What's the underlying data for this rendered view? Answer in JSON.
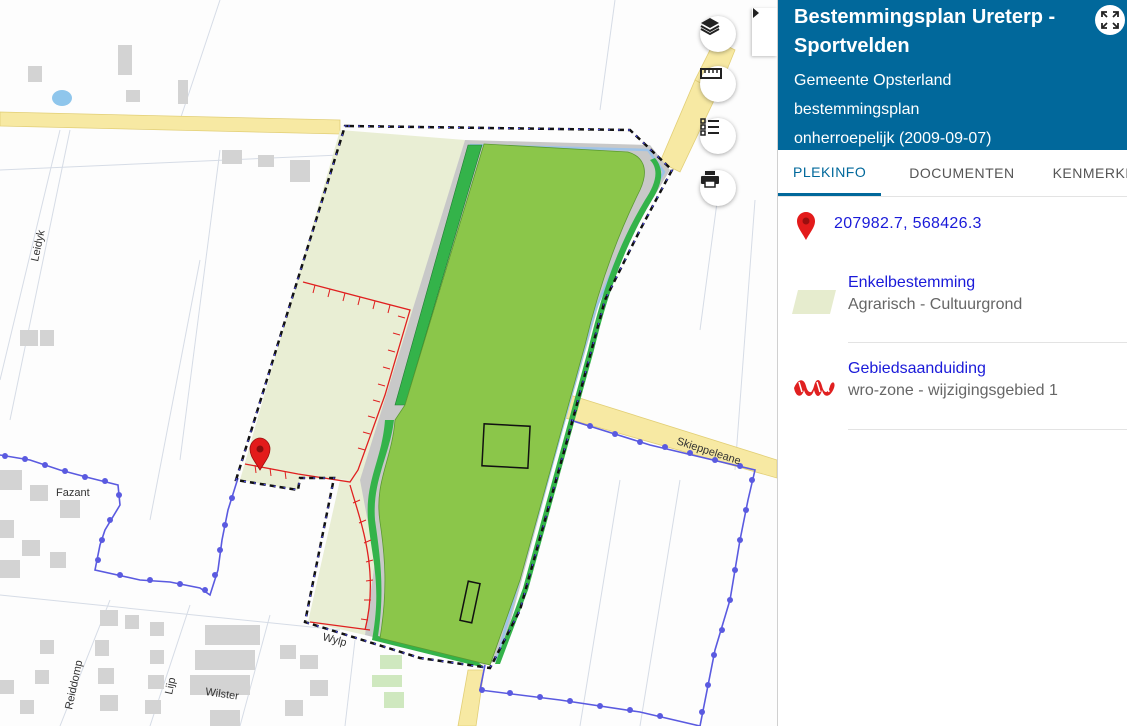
{
  "map": {
    "street_labels": [
      "Leidyk",
      "Fazant",
      "Wylp",
      "Skieppeleane",
      "Reiddomp",
      "Lijp",
      "Wilster"
    ],
    "controls": [
      "layers-icon",
      "ruler-icon",
      "legend-icon",
      "print-icon"
    ],
    "colors": {
      "sport_green": "#8bc64a",
      "dark_green": "#34b34a",
      "agrarisch": "#e9eed4",
      "road_yellow": "#f7e9a3",
      "gray_strip": "#c8c8c8",
      "boundary_black": "#111111",
      "boundary_blue": "#5a5ae0",
      "zone_red": "#e02020"
    }
  },
  "panel": {
    "title": "Bestemmingsplan Ureterp - Sportvelden",
    "municipality": "Gemeente Opsterland",
    "type": "bestemmingsplan",
    "status": "onherroepelijk (2009-09-07)",
    "tabs": [
      "PLEKINFO",
      "DOCUMENTEN",
      "KENMERKEN"
    ],
    "active_tab": "PLEKINFO",
    "coordinates": "207982.7, 568426.3",
    "items": [
      {
        "title": "Enkelbestemming",
        "value": "Agrarisch - Cultuurgrond",
        "icon": "agrarisch-swatch-icon"
      },
      {
        "title": "Gebiedsaanduiding",
        "value": "wro-zone - wijzigingsgebied 1",
        "icon": "wro-zone-swatch-icon"
      }
    ]
  }
}
